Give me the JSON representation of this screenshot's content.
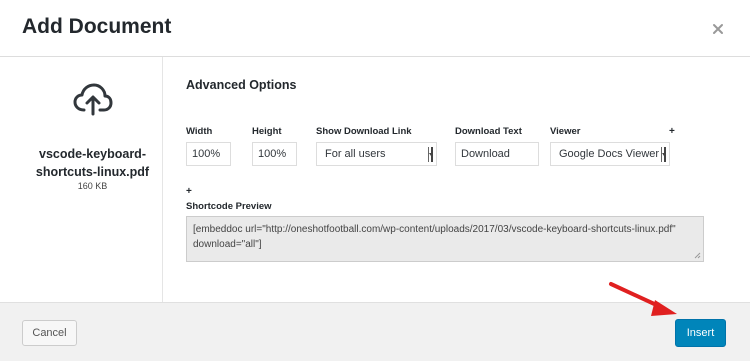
{
  "modal": {
    "title": "Add Document",
    "close_icon": "close-icon"
  },
  "file": {
    "icon": "cloud-upload-icon",
    "name": "vscode-keyboard-shortcuts-linux.pdf",
    "size": "160 KB"
  },
  "options": {
    "title": "Advanced Options",
    "width": {
      "label": "Width",
      "value": "100%"
    },
    "height": {
      "label": "Height",
      "value": "100%"
    },
    "download_link": {
      "label": "Show Download Link",
      "selected": "For all users"
    },
    "download_text": {
      "label": "Download Text",
      "value": "Download"
    },
    "viewer": {
      "label": "Viewer",
      "selected": "Google Docs Viewer"
    },
    "plus_1": "+",
    "plus_2": "+",
    "shortcode_label": "Shortcode Preview",
    "shortcode": "[embeddoc url=\"http://oneshotfootball.com/wp-content/uploads/2017/03/vscode-keyboard-shortcuts-linux.pdf\" download=\"all\"]"
  },
  "footer": {
    "cancel_label": "Cancel",
    "insert_label": "Insert"
  },
  "colors": {
    "primary_button": "#0085ba",
    "annotation_arrow": "#e02020"
  }
}
